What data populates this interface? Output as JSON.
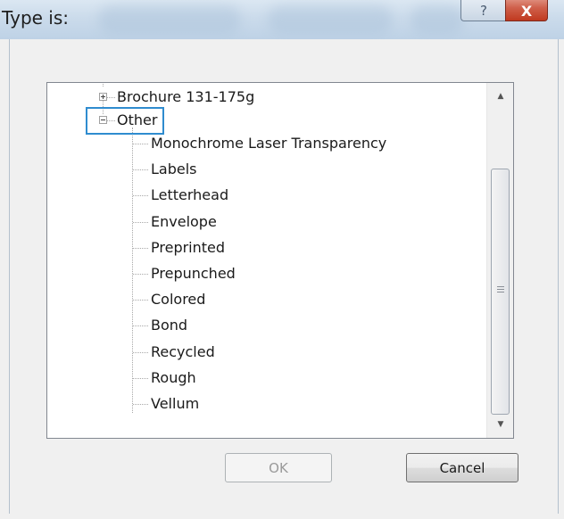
{
  "window": {
    "title": "Type is:",
    "help_glyph": "?",
    "close_glyph": "X"
  },
  "tree": {
    "parents": [
      {
        "label": "Brochure 131-175g",
        "state": "collapsed"
      },
      {
        "label": "Other",
        "state": "expanded",
        "highlighted": true
      }
    ],
    "children": [
      "Monochrome Laser Transparency",
      "Labels",
      "Letterhead",
      "Envelope",
      "Preprinted",
      "Prepunched",
      "Colored",
      "Bond",
      "Recycled",
      "Rough",
      "Vellum"
    ]
  },
  "scrollbar": {
    "up_glyph": "▲",
    "down_glyph": "▼"
  },
  "buttons": {
    "ok": "OK",
    "ok_enabled": false,
    "cancel": "Cancel"
  }
}
